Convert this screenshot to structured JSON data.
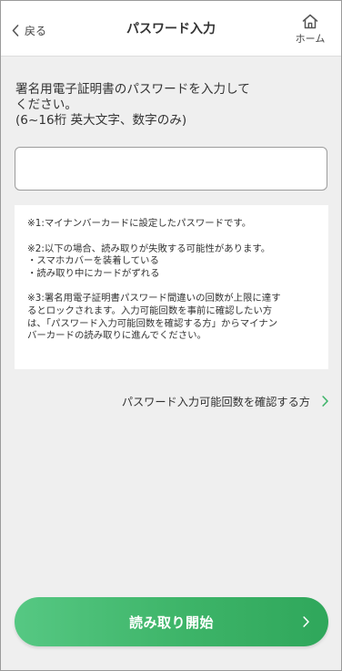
{
  "header": {
    "back_label": "戻る",
    "title": "パスワード入力",
    "home_label": "ホーム"
  },
  "instruction": {
    "line1": "署名用電子証明書のパスワードを入力して",
    "line2": "ください。",
    "line3": "(6~16桁 英大文字、数字のみ)"
  },
  "password_input": {
    "value": "",
    "placeholder": ""
  },
  "notes": {
    "note1": "※1:マイナンバーカードに設定したパスワードです。",
    "note2_lines": [
      "※2:以下の場合、読み取りが失敗する可能性があります。",
      "・スマホカバーを装着している",
      "・読み取り中にカードがずれる"
    ],
    "note3_lines": [
      "※3:署名用電子証明書パスワード間違いの回数が上限に達す",
      "るとロックされます。入力可能回数を事前に確認したい方",
      "は、「パスワード入力可能回数を確認する方」からマイナン",
      "バーカードの読み取りに進んでください。"
    ]
  },
  "link": {
    "label": "パスワード入力可能回数を確認する方"
  },
  "start_button": {
    "label": "読み取り開始"
  },
  "icons": {
    "back": "chevron-left-icon",
    "home": "home-icon",
    "link_chevron": "chevron-right-icon",
    "button_chevron": "chevron-right-icon"
  },
  "colors": {
    "accent": "#3db468",
    "background": "#efefef",
    "header": "#ffffff"
  }
}
